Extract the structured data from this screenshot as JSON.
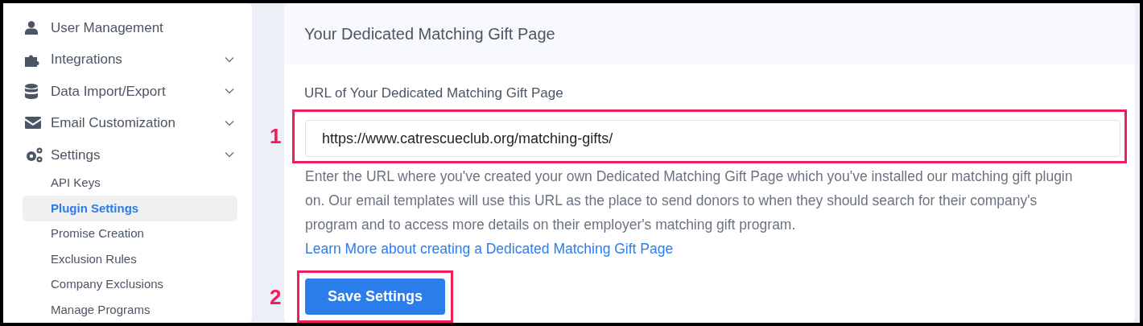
{
  "sidebar": {
    "items": [
      {
        "label": "User Management",
        "expandable": false
      },
      {
        "label": "Integrations",
        "expandable": true
      },
      {
        "label": "Data Import/Export",
        "expandable": true
      },
      {
        "label": "Email Customization",
        "expandable": true
      },
      {
        "label": "Settings",
        "expandable": true,
        "children": [
          {
            "label": "API Keys",
            "selected": false
          },
          {
            "label": "Plugin Settings",
            "selected": true
          },
          {
            "label": "Promise Creation",
            "selected": false
          },
          {
            "label": "Exclusion Rules",
            "selected": false
          },
          {
            "label": "Company Exclusions",
            "selected": false
          },
          {
            "label": "Manage Programs",
            "selected": false
          }
        ]
      }
    ]
  },
  "card": {
    "title": "Your Dedicated Matching Gift Page",
    "field": {
      "label": "URL of Your Dedicated Matching Gift Page",
      "value": "https://www.catrescueclub.org/matching-gifts/",
      "annotation": "1"
    },
    "help_text": "Enter the URL where you've created your own Dedicated Matching Gift Page which you've installed our matching gift plugin on. Our email templates will use this URL as the place to send donors to when they should search for their company's program and to access more details on their employer's matching gift program.",
    "help_link": "Learn More about creating a Dedicated Matching Gift Page",
    "button": {
      "label": "Save Settings",
      "annotation": "2"
    }
  }
}
